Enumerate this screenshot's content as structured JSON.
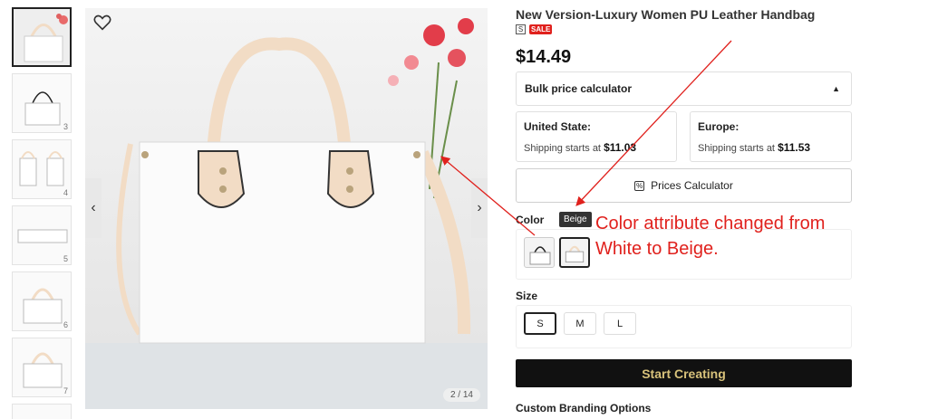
{
  "gallery": {
    "thumbnail_numbers": [
      "",
      "3",
      "4",
      "5",
      "6",
      "7"
    ],
    "counter": "2 / 14",
    "prev_icon": "‹",
    "next_icon": "›"
  },
  "product": {
    "title": "New Version-Luxury Women PU Leather Handbag",
    "badge_s": "S",
    "badge_sale": "SALE",
    "price": "$14.49"
  },
  "bulk_calculator": {
    "label": "Bulk price calculator",
    "toggle_icon": "▲"
  },
  "shipping": [
    {
      "region": "United State:",
      "prefix": "Shipping starts at",
      "amount": "$11.03"
    },
    {
      "region": "Europe:",
      "prefix": "Shipping starts at",
      "amount": "$11.53"
    }
  ],
  "prices_calculator": {
    "label": "Prices Calculator"
  },
  "color": {
    "label": "Color",
    "tooltip": "Beige",
    "options": [
      "White",
      "Beige"
    ],
    "selected": "Beige"
  },
  "size": {
    "label": "Size",
    "options": [
      "S",
      "M",
      "L"
    ],
    "selected": "S"
  },
  "cta": {
    "start_label": "Start Creating"
  },
  "branding": {
    "label": "Custom Branding Options"
  },
  "annotation": {
    "line1": "Color attribute changed from",
    "line2": "White to Beige.",
    "color": "#e0211d"
  }
}
